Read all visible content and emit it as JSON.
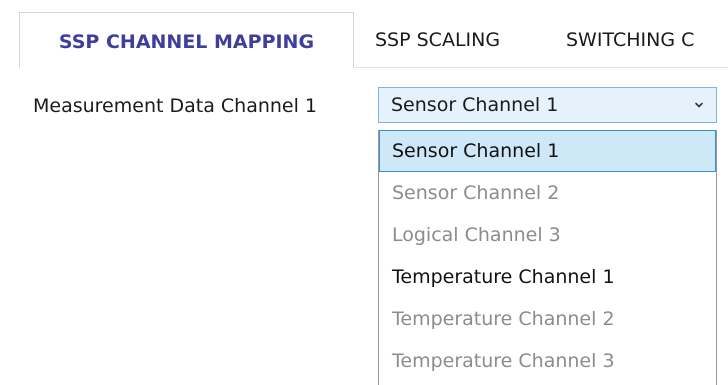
{
  "tabs": [
    {
      "label": "SSP CHANNEL MAPPING",
      "active": true
    },
    {
      "label": "SSP SCALING",
      "active": false
    },
    {
      "label": "SWITCHING C",
      "active": false
    }
  ],
  "field": {
    "label": "Measurement Data Channel 1",
    "selected_value": "Sensor Channel 1"
  },
  "dropdown": {
    "options": [
      {
        "label": "Sensor Channel 1",
        "state": "selected"
      },
      {
        "label": "Sensor Channel 2",
        "state": "disabled"
      },
      {
        "label": "Logical Channel 3",
        "state": "disabled"
      },
      {
        "label": "Temperature Channel 1",
        "state": "enabled"
      },
      {
        "label": "Temperature Channel 2",
        "state": "disabled"
      },
      {
        "label": "Temperature Channel 3",
        "state": "disabled"
      }
    ]
  },
  "colors": {
    "active_tab_text": "#3e3e9c",
    "select_background": "#e5f1fb",
    "select_border": "#7fb2e0",
    "selected_option_background": "#cfe8f7",
    "selected_option_border": "#3a8ed6",
    "disabled_text": "#8c8c8c"
  },
  "icons": {
    "select_arrow": "chevron-down-icon"
  }
}
